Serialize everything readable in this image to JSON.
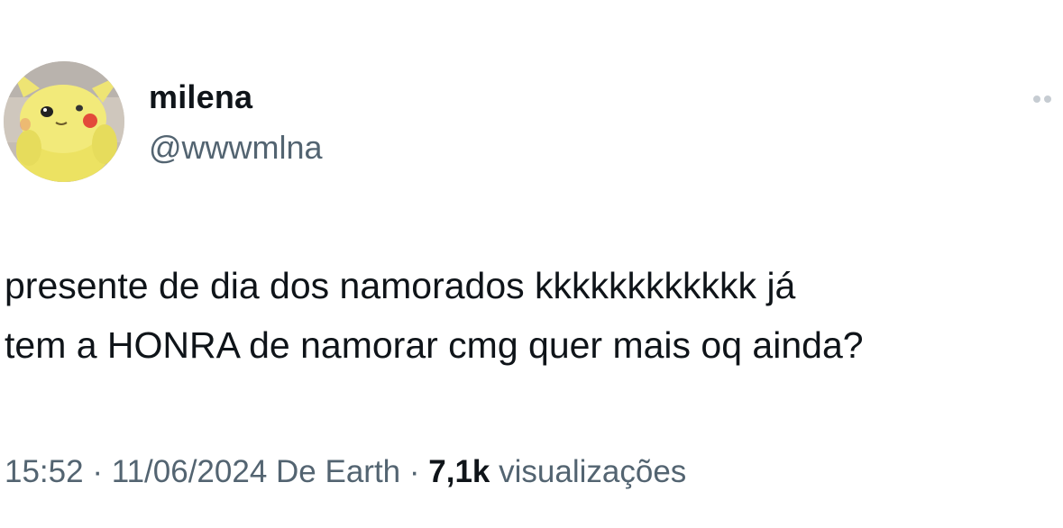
{
  "author": {
    "display_name": "milena",
    "handle": "@wwwmlna",
    "avatar_icon": "pikachu-plush-avatar"
  },
  "tweet": {
    "text_lines": [
      "presente de dia dos namorados kkkkkkkkkkkk já",
      "tem a HONRA de namorar cmg quer mais oq ainda?"
    ]
  },
  "meta": {
    "time": "15:52",
    "separator": "·",
    "date": "11/06/2024",
    "location": "De Earth",
    "views_count": "7,1k",
    "views_label": "visualizações"
  },
  "colors": {
    "text_primary": "#0f1419",
    "text_secondary": "#536471",
    "avatar_yellow": "#f2ea7a"
  },
  "icons": {
    "more": "more-dots-icon"
  }
}
